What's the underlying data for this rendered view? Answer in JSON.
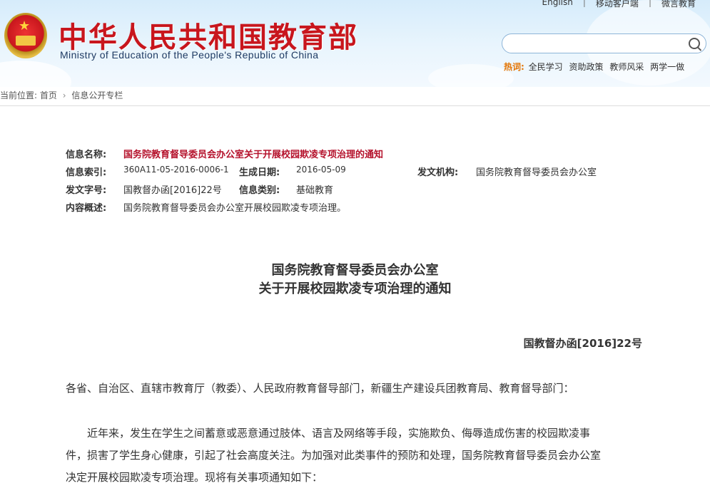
{
  "header": {
    "site_title": "中华人民共和国教育部",
    "site_subtitle": "Ministry of Education of the People's Republic of China",
    "top_links": [
      "English",
      "移动客户端",
      "微言教育"
    ],
    "search_placeholder": "",
    "hot_label": "热词:",
    "hot_words": [
      "全民学习",
      "资助政策",
      "教师风采",
      "两学一做"
    ]
  },
  "breadcrumb": {
    "prefix": "当前位置:",
    "items": [
      "首页",
      "信息公开专栏"
    ]
  },
  "meta": {
    "name_label": "信息名称:",
    "name_value": "国务院教育督导委员会办公室关于开展校园欺凌专项治理的通知",
    "index_label": "信息索引:",
    "index_value": "360A11-05-2016-0006-1",
    "date_label": "生成日期:",
    "date_value": "2016-05-09",
    "org_label": "发文机构:",
    "org_value": "国务院教育督导委员会办公室",
    "docno_label": "发文字号:",
    "docno_value": "国教督办函[2016]22号",
    "category_label": "信息类别:",
    "category_value": "基础教育",
    "summary_label": "内容概述:",
    "summary_value": "国务院教育督导委员会办公室开展校园欺凌专项治理。"
  },
  "document": {
    "title_line1": "国务院教育督导委员会办公室",
    "title_line2": "关于开展校园欺凌专项治理的通知",
    "doc_number": "国教督办函[2016]22号",
    "salutation": "各省、自治区、直辖市教育厅（教委）、人民政府教育督导部门，新疆生产建设兵团教育局、教育督导部门：",
    "para1_line1": "　　近年来，发生在学生之间蓄意或恶意通过肢体、语言及网络等手段，实施欺负、侮辱造成伤害的校园欺凌事",
    "para1_line2": "件，损害了学生身心健康，引起了社会高度关注。为加强对此类事件的预防和处理，国务院教育督导委员会办公室",
    "para1_line3": "决定开展校园欺凌专项治理。现将有关事项通知如下："
  },
  "colors": {
    "title_red": "#c8161d",
    "meta_red": "#b5122c",
    "hot_orange": "#e37300"
  }
}
